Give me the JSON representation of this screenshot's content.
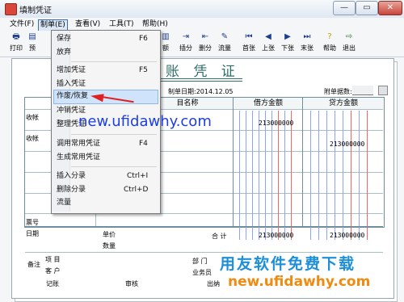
{
  "window": {
    "title": "填制凭证",
    "min_label": "—",
    "max_label": "▭",
    "close_label": "✕"
  },
  "menubar": {
    "items": [
      "文件(F)",
      "制单(E)",
      "查看(V)",
      "工具(T)",
      "帮助(H)"
    ]
  },
  "toolbar": {
    "buttons": [
      {
        "label": "打印",
        "icon": "printer-icon",
        "glyph": "🖶"
      },
      {
        "label": "预",
        "icon": "preview-icon",
        "glyph": "▤"
      },
      {
        "label": "额",
        "icon": "balance-icon",
        "glyph": "▥"
      },
      {
        "label": "插分",
        "icon": "insert-row-icon",
        "glyph": "⇥"
      },
      {
        "label": "删分",
        "icon": "delete-row-icon",
        "glyph": "⇤"
      },
      {
        "label": "流量",
        "icon": "cashflow-icon",
        "glyph": "✎"
      },
      {
        "label": "首张",
        "icon": "first-record-icon",
        "glyph": "⏮"
      },
      {
        "label": "上张",
        "icon": "previous-record-icon",
        "glyph": "◀"
      },
      {
        "label": "下张",
        "icon": "next-record-icon",
        "glyph": "▶"
      },
      {
        "label": "末张",
        "icon": "last-record-icon",
        "glyph": "⏭"
      },
      {
        "label": "帮助",
        "icon": "help-icon",
        "glyph": "?"
      },
      {
        "label": "退出",
        "icon": "exit-icon",
        "glyph": "⇨"
      }
    ]
  },
  "menu_zhidan": {
    "items": [
      {
        "label": "保存",
        "shortcut": "F6"
      },
      {
        "label": "放弃",
        "shortcut": ""
      },
      {
        "label": "增加凭证",
        "shortcut": "F5"
      },
      {
        "label": "插入凭证",
        "shortcut": ""
      },
      {
        "label": "作废/恢复",
        "shortcut": ""
      },
      {
        "label": "冲销凭证",
        "shortcut": ""
      },
      {
        "label": "整理凭证",
        "shortcut": ""
      },
      {
        "label": "调用常用凭证",
        "shortcut": "F4"
      },
      {
        "label": "生成常用凭证",
        "shortcut": ""
      },
      {
        "label": "插入分录",
        "shortcut": "Ctrl+I"
      },
      {
        "label": "删除分录",
        "shortcut": "Ctrl+D"
      },
      {
        "label": "流量",
        "shortcut": ""
      }
    ],
    "highlighted": "作废/恢复"
  },
  "voucher": {
    "heading": "账 凭 证",
    "date_label": "制单日期:2014.12.05",
    "attachments_label": "附单据数:",
    "col_account": "目名称",
    "col_debit": "借方金额",
    "col_credit": "贷方金额",
    "rows": [
      {
        "summary": "收帐",
        "debit": "213000000",
        "credit": ""
      },
      {
        "summary": "收帐",
        "debit": "",
        "credit": "213000000"
      }
    ],
    "total_debit": "213000000",
    "total_credit": "213000000",
    "ticket_no_label": "票号",
    "date_field_label": "日期",
    "unit_price_label": "单价",
    "quantity_label": "数量",
    "total_label": "合 计",
    "remark_label": "备注",
    "project_label": "项  目",
    "customer_label": "客  户",
    "department_label": "部  门",
    "salesman_label": "业务员",
    "bookkeeper_label": "记账",
    "auditor_label": "审核",
    "cashier_label": "出纳"
  },
  "watermarks": {
    "url_blue": "new.ufidawhy.com",
    "brand": "用友软件免费下载",
    "url_orange": "new.ufidawhy.com"
  },
  "colors": {
    "accent": "#2f6f6a",
    "arrow": "#e02020",
    "watermark_blue": "#1d3fe0",
    "watermark_brand": "#1d8fd8",
    "watermark_orange": "#f08a10"
  }
}
